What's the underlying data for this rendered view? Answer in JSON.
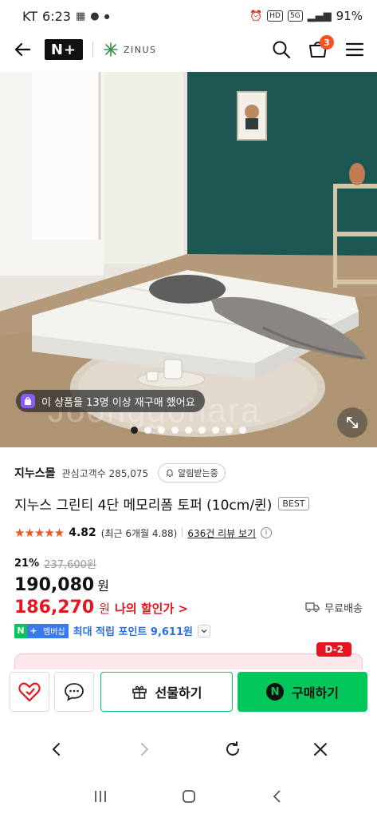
{
  "status_bar": {
    "carrier": "KT",
    "time": "6:23",
    "battery": "91%",
    "icons": [
      "calendar-icon",
      "chat-bubble-icon",
      "dot-icon",
      "alarm-icon",
      "hd-icon",
      "5g-icon",
      "signal-icon"
    ]
  },
  "header": {
    "logo": "N+",
    "brand": "ZINUS",
    "cart_count": "3",
    "icons": [
      "back-arrow-icon",
      "search-icon",
      "cart-icon",
      "menu-icon"
    ]
  },
  "hero": {
    "rebuy_text": "이 상품을 13명 이상 재구매 했어요",
    "watermark": "Joonggonara",
    "slide_count": 9,
    "active_slide": 1
  },
  "store": {
    "name": "지누스몰",
    "interest_label": "관심고객수 285,075",
    "alarm_label": "알림받는중"
  },
  "product": {
    "title": "지누스 그린티 4단 메모리폼 토퍼 (10cm/퀸)",
    "badge": "BEST",
    "stars": "★★★★★",
    "rating": "4.82",
    "rating_recent": "(최근 6개월 4.88)",
    "review_link": "636건 리뷰 보기",
    "discount_rate": "21%",
    "original_price": "237,600원",
    "price": "190,080",
    "price_unit": "원",
    "my_price": "186,270",
    "my_price_unit": "원",
    "my_price_label": "나의 할인가 >",
    "shipping": "무료배송",
    "membership_label": "멤버십",
    "points_text": "최대 적립 포인트 9,611원",
    "d_day_badge": "D-2"
  },
  "actions": {
    "gift_label": "선물하기",
    "buy_label": "구매하기"
  },
  "colors": {
    "accent_green": "#03c75a",
    "sale_red": "#e8141f",
    "star_orange": "#f5521f",
    "point_blue": "#2c6ef2"
  }
}
